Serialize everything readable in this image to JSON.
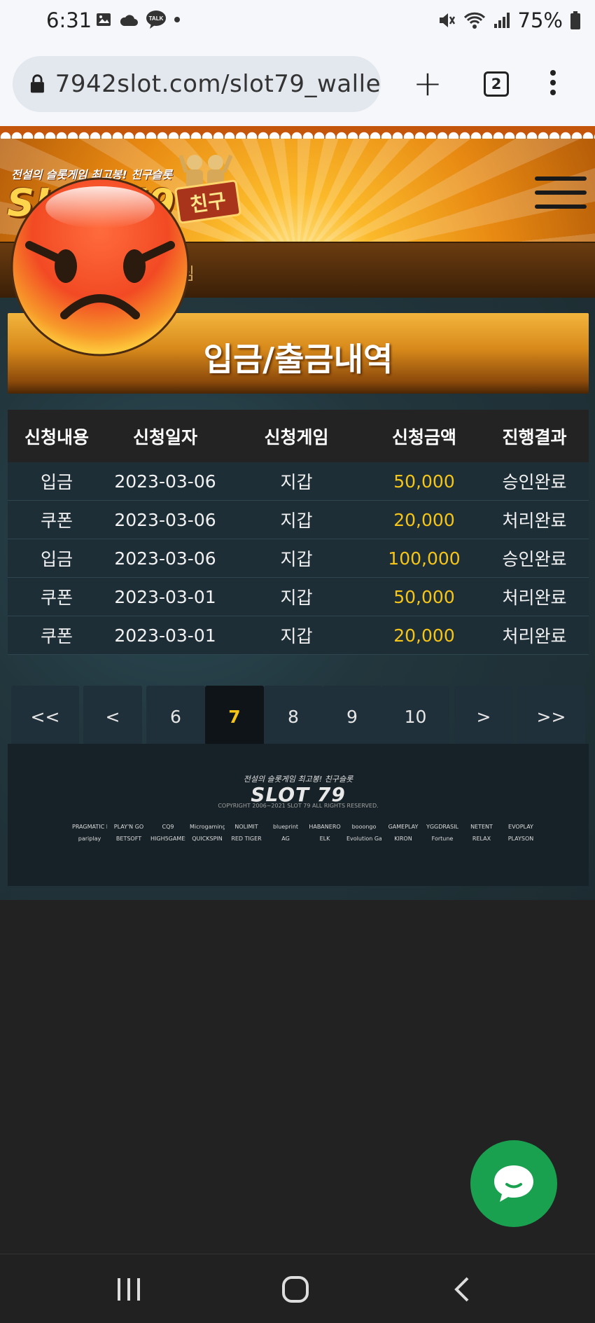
{
  "status_bar": {
    "time": "6:31",
    "battery_pct": "75%"
  },
  "browser": {
    "url": "7942slot.com/slot79_walle",
    "tab_count": "2"
  },
  "site": {
    "tagline": "전설의 슬롯게임 최고봉! 친구슬롯",
    "logo_text": "SLOT79",
    "logo_badge": "친구",
    "subnav_text": "님"
  },
  "page": {
    "title": "입금/출금내역"
  },
  "table": {
    "headers": [
      "신청내용",
      "신청일자",
      "신청게임",
      "신청금액",
      "진행결과"
    ],
    "rows": [
      {
        "type": "입금",
        "date": "2023-03-06",
        "game": "지갑",
        "amount": "50,000",
        "result": "승인완료"
      },
      {
        "type": "쿠폰",
        "date": "2023-03-06",
        "game": "지갑",
        "amount": "20,000",
        "result": "처리완료"
      },
      {
        "type": "입금",
        "date": "2023-03-06",
        "game": "지갑",
        "amount": "100,000",
        "result": "승인완료"
      },
      {
        "type": "쿠폰",
        "date": "2023-03-01",
        "game": "지갑",
        "amount": "50,000",
        "result": "처리완료"
      },
      {
        "type": "쿠폰",
        "date": "2023-03-01",
        "game": "지갑",
        "amount": "20,000",
        "result": "처리완료"
      }
    ]
  },
  "pagination": {
    "first": "<<",
    "prev": "<",
    "pages": [
      "6",
      "7",
      "8",
      "9",
      "10"
    ],
    "current": "7",
    "next": ">",
    "last": ">>"
  },
  "footer": {
    "tagline": "전설의 슬롯게임 최고봉! 친구슬롯",
    "logo": "SLOT 79",
    "copyright": "COPYRIGHT 2006~2021 SLOT 79 ALL RIGHTS RESERVED.",
    "providers": [
      "PRAGMATIC PLAY",
      "PLAY'N GO",
      "CQ9",
      "Microgaming",
      "NOLIMIT",
      "blueprint",
      "HABANERO",
      "booongo",
      "GAMEPLAY",
      "YGGDRASIL",
      "NETENT",
      "EVOPLAY",
      "pariplay",
      "BETSOFT",
      "HIGH5GAMES",
      "QUICKSPIN",
      "RED TIGER",
      "AG",
      "ELK",
      "Evolution Gaming",
      "KIRON",
      "Fortune",
      "RELAX",
      "PLAYSON"
    ]
  },
  "colors": {
    "accent_gold": "#f5c518",
    "chat_green": "#1aa150",
    "row_bg": "#1d2e37"
  },
  "icons": [
    "lock-icon",
    "plus-icon",
    "tab-switcher-icon",
    "more-vert-icon",
    "hamburger-icon",
    "chat-icon",
    "recents-icon",
    "home-icon",
    "back-icon",
    "angry-face-icon"
  ]
}
